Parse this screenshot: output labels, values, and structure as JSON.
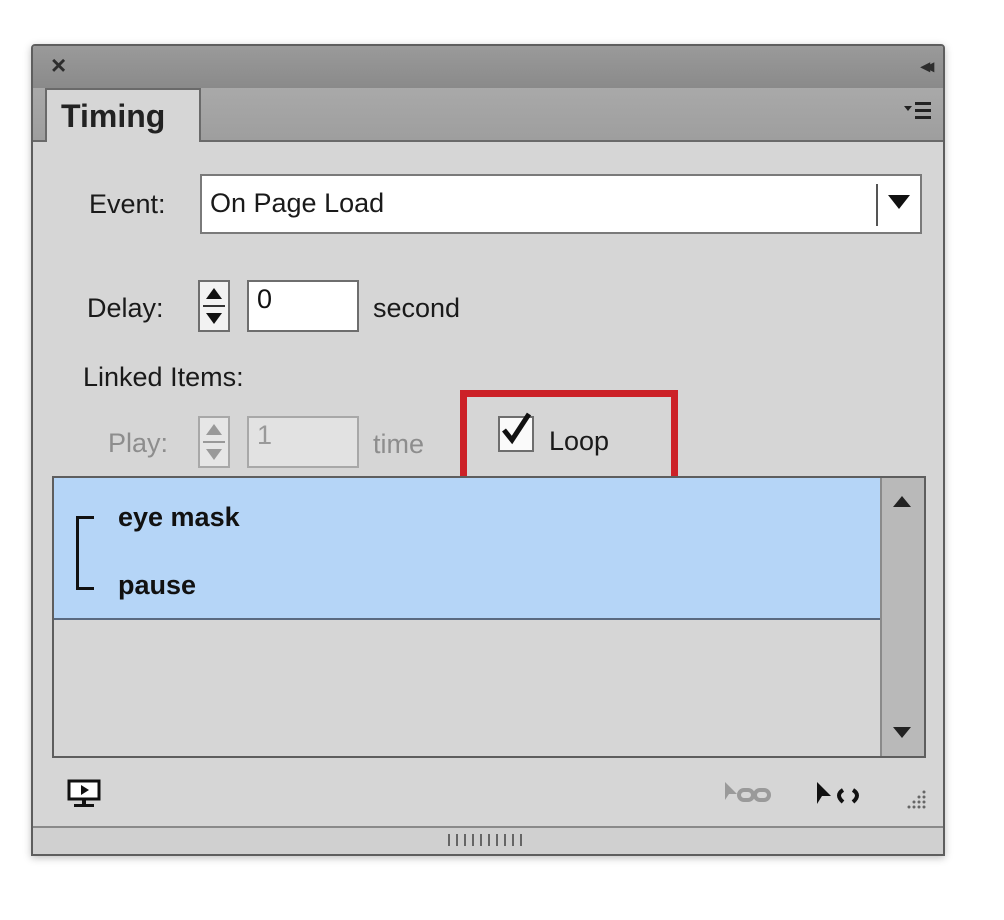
{
  "panel": {
    "tab_label": "Timing"
  },
  "event": {
    "label": "Event:",
    "value": "On Page Load"
  },
  "delay": {
    "label": "Delay:",
    "value": "0",
    "unit": "second"
  },
  "linked": {
    "label": "Linked Items:"
  },
  "play": {
    "label": "Play:",
    "value": "1",
    "unit": "time"
  },
  "loop": {
    "label": "Loop",
    "checked": true
  },
  "items": [
    "eye mask",
    "pause"
  ],
  "colors": {
    "selection": "#b5d5f7",
    "highlight_box": "#cc2127"
  },
  "icons": [
    "close-icon",
    "collapse-icon",
    "panel-menu-icon",
    "chevron-down-icon",
    "preview-icon",
    "unlink-icon",
    "link-icon",
    "resize-grip-icon"
  ]
}
